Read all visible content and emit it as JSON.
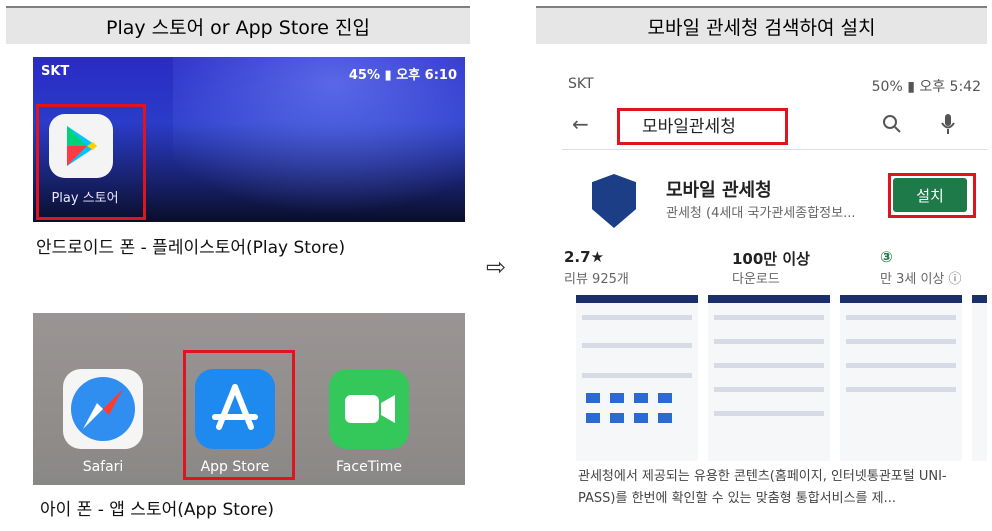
{
  "left_header": "Play 스토어 or App Store 진입",
  "right_header": "모바일 관세청 검색하여 설치",
  "android": {
    "status_left": "SKT",
    "status_right": "45% ▮ 오후 6:10",
    "app_label": "Play 스토어",
    "caption": "안드로이드 폰 - 플레이스토어(Play Store)"
  },
  "ios": {
    "apps": [
      "Safari",
      "App Store",
      "FaceTime"
    ],
    "caption": "아이 폰 - 앱 스토어(App Store)"
  },
  "arrow": "⇨",
  "phone": {
    "status_left": "SKT",
    "status_right": "50% ▮ 오후 5:42",
    "search_query": "모바일관세청",
    "app_name": "모바일 관세청",
    "developer": "관세청 (4세대 국가관세종합정보...",
    "install_label": "설치",
    "stats": [
      {
        "value": "2.7★",
        "label": "리뷰 925개"
      },
      {
        "value": "100만 이상",
        "label": "다운로드"
      },
      {
        "value": "③",
        "label": "만 3세 이상 ⓘ"
      }
    ],
    "description": "관세청에서 제공되는 유용한 콘텐츠(홈페이지, 인터넷통관포털 UNI-PASS)를 한번에 확인할 수 있는 맞춤형 통합서비스를 제..."
  }
}
